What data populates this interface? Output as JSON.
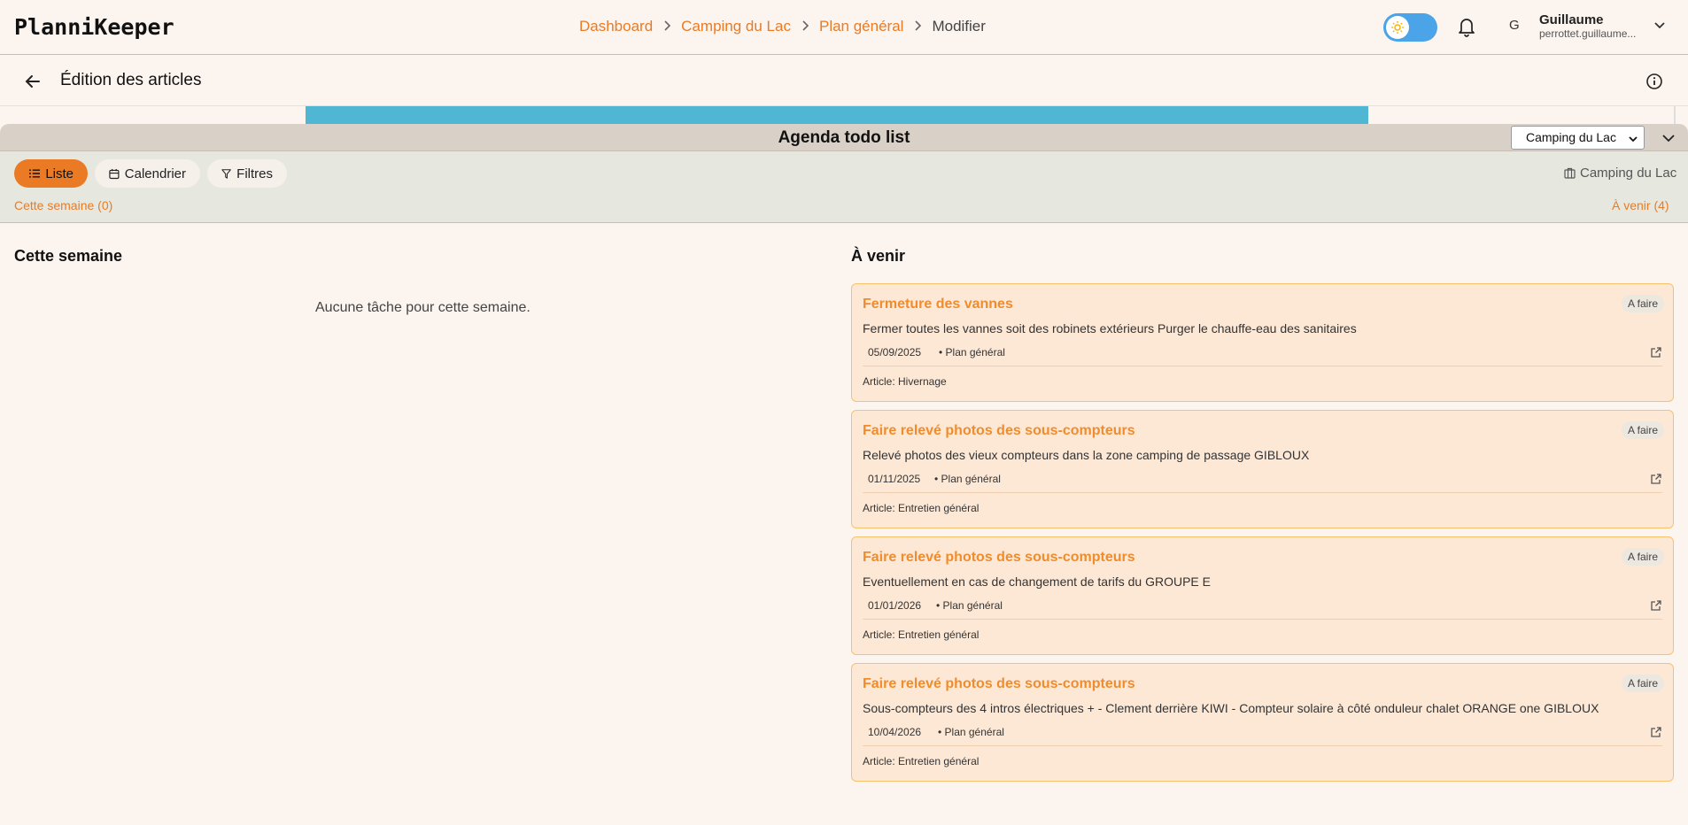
{
  "app": {
    "logo": "PlanniKeeper"
  },
  "breadcrumb": {
    "items": [
      "Dashboard",
      "Camping du Lac",
      "Plan général"
    ],
    "current": "Modifier"
  },
  "user": {
    "initial": "G",
    "name": "Guillaume",
    "email": "perrottet.guillaume..."
  },
  "subheader": {
    "title": "Édition des articles"
  },
  "panel": {
    "title": "Agenda todo list",
    "site_select": "Camping du Lac"
  },
  "toolbar": {
    "liste": "Liste",
    "calendrier": "Calendrier",
    "filtres": "Filtres",
    "site": "Camping du Lac",
    "week_link": "Cette semaine (0)",
    "upcoming_link": "À venir (4)"
  },
  "week": {
    "title": "Cette semaine",
    "empty": "Aucune tâche pour cette semaine."
  },
  "upcoming": {
    "title": "À venir",
    "tasks": [
      {
        "title": "Fermeture des vannes",
        "status": "A faire",
        "description": "Fermer toutes les vannes soit des robinets extérieurs Purger le chauffe-eau des sanitaires",
        "date": "05/09/2025",
        "plan": "• Plan général",
        "article": "Article: Hivernage"
      },
      {
        "title": "Faire relevé photos des sous-compteurs",
        "status": "A faire",
        "description": "Relevé photos des vieux compteurs dans la zone camping de passage GIBLOUX",
        "date": "01/11/2025",
        "plan": "• Plan général",
        "article": "Article: Entretien général"
      },
      {
        "title": "Faire relevé photos des sous-compteurs",
        "status": "A faire",
        "description": "Eventuellement en cas de changement de tarifs du GROUPE E",
        "date": "01/01/2026",
        "plan": "• Plan général",
        "article": "Article: Entretien général"
      },
      {
        "title": "Faire relevé photos des sous-compteurs",
        "status": "A faire",
        "description": "Sous-compteurs des 4 intros électriques + - Clement derrière KIWI - Compteur solaire à côté onduleur chalet ORANGE one GIBLOUX",
        "date": "10/04/2026",
        "plan": "• Plan général",
        "article": "Article: Entretien général"
      }
    ]
  },
  "colors": {
    "accent": "#ea7b24",
    "card_bg": "#fde8d6",
    "toggle": "#4ba3e8"
  },
  "icons": [
    "sun-icon",
    "bell-icon",
    "chevron-down-icon",
    "arrow-left-icon",
    "info-icon",
    "list-icon",
    "calendar-icon",
    "filter-icon",
    "building-icon",
    "external-link-icon"
  ]
}
